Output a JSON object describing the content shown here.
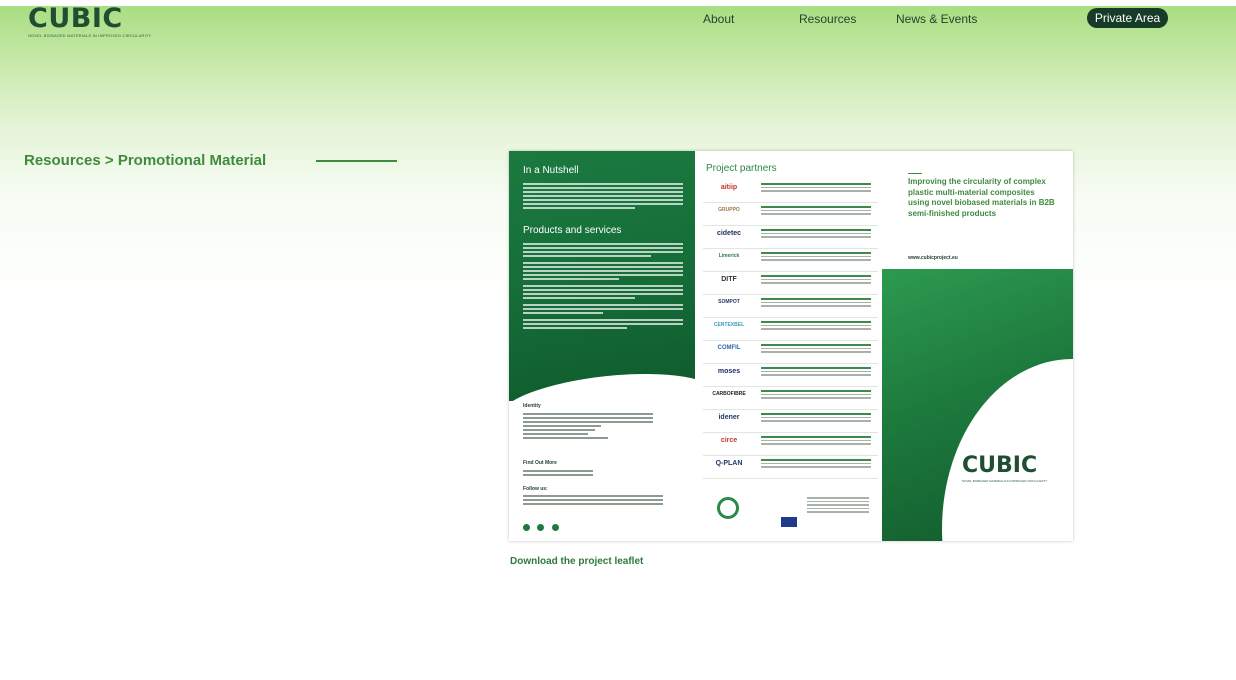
{
  "header": {
    "logo": "CUBIC",
    "logo_tagline": "NOVEL BIOBASED MATERIALS IN IMPROVED CIRCULARITY",
    "nav": [
      "About",
      "Resources",
      "News & Events"
    ],
    "private_area": "Private Area"
  },
  "breadcrumb": {
    "section": "Resources",
    "separator": ">",
    "page": "Promotional Material"
  },
  "leaflet": {
    "panel1": {
      "heading1": "In a Nutshell",
      "heading2": "Products and services",
      "identity": "Identity",
      "find_out_more": "Find Out More",
      "follow_us": "Follow us:"
    },
    "panel2": {
      "title": "Project partners",
      "partners": [
        "aitiip",
        "GRUPPO",
        "cidetec",
        "Limerick",
        "DITF",
        "SOMPOT",
        "CENTEXBEL",
        "COMFIL",
        "moses",
        "CARBOFIBRE",
        "idener",
        "circe",
        "Q-PLAN"
      ]
    },
    "panel3": {
      "title": "Improving the circularity of complex plastic multi-material composites using novel biobased materials in B2B semi-finished products",
      "url": "www.cubicproject.eu",
      "logo": "CUBIC"
    }
  },
  "download_link": "Download the project leaflet",
  "colors": {
    "brand_dark": "#163b27",
    "accent_green": "#3f8b3e",
    "leaflet_green": "#1b7a40"
  }
}
